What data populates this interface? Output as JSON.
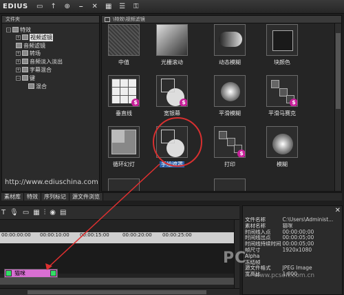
{
  "app": {
    "brand": "EDIUS"
  },
  "tree": {
    "header": "文件夹",
    "items": [
      {
        "label": "特效",
        "expander": "−",
        "selected": false
      },
      {
        "label": "视频滤镜",
        "expander": "+",
        "selected": true
      },
      {
        "label": "音频滤镜",
        "expander": "",
        "selected": false
      },
      {
        "label": "转场",
        "expander": "+",
        "selected": false
      },
      {
        "label": "音频淡入淡出",
        "expander": "+",
        "selected": false
      },
      {
        "label": "字幕混合",
        "expander": "+",
        "selected": false
      },
      {
        "label": "键",
        "expander": "−",
        "selected": false
      },
      {
        "label": "混合",
        "expander": "",
        "selected": false
      }
    ],
    "watermark": "http://www.ediuschina.com"
  },
  "bottom_tabs": [
    "素材库",
    "特效",
    "序列标记",
    "源文件浏览"
  ],
  "grid": {
    "path": "\\特效\\视频滤镜",
    "effects": [
      {
        "name": "中值",
        "icon": "noise-thumb-icon",
        "badge": false
      },
      {
        "name": "光栅滚动",
        "icon": "wave-thumb-icon",
        "badge": false
      },
      {
        "name": "动态模糊",
        "icon": "motion-blur-thumb-icon",
        "badge": false
      },
      {
        "name": "块颜色",
        "icon": "color-block-thumb-icon",
        "badge": false
      },
      {
        "name": "垂直线",
        "icon": "grid-lines-thumb-icon",
        "badge": true
      },
      {
        "name": "宽银幕",
        "icon": "curve-thumb-icon",
        "badge": true
      },
      {
        "name": "平滑模糊",
        "icon": "blur-sphere-thumb-icon",
        "badge": false
      },
      {
        "name": "平滑马赛克",
        "icon": "mosaic-thumb-icon",
        "badge": true
      },
      {
        "name": "循环幻灯",
        "icon": "loop-slide-thumb-icon",
        "badge": false
      },
      {
        "name": "手绘遮罩",
        "icon": "hand-mask-thumb-icon",
        "badge": false
      },
      {
        "name": "打印",
        "icon": "print-thumb-icon",
        "badge": true
      },
      {
        "name": "模糊",
        "icon": "blur-thumb-icon",
        "badge": false
      }
    ],
    "selected": "手绘遮罩"
  },
  "timeline": {
    "ruler_ticks": [
      "00:00:00:00",
      "00:00:10:00",
      "00:00:15:00",
      "00:00:20:00",
      "00:00:25:00"
    ],
    "clip": {
      "label": "猫咪"
    }
  },
  "info": {
    "rows": [
      {
        "k": "文件名称",
        "v": "C:\\Users\\Administ..."
      },
      {
        "k": "素材名称",
        "v": "猫咪"
      },
      {
        "k": "时间线入点",
        "v": "00:00:00;00"
      },
      {
        "k": "时间线出点",
        "v": "00:00:05;00"
      },
      {
        "k": "时间线持续时间",
        "v": "00:00:05;00"
      },
      {
        "k": "帧尺寸",
        "v": "1920x1080"
      },
      {
        "k": "Alpha",
        "v": ""
      },
      {
        "k": "冻结帧",
        "v": ""
      },
      {
        "k": "源文件格式",
        "v": "JPEG Image"
      },
      {
        "k": "宽高比",
        "v": "1.000"
      }
    ]
  },
  "watermarks": {
    "pc": "PC",
    "site": "www.pcsoft.com.cn"
  }
}
